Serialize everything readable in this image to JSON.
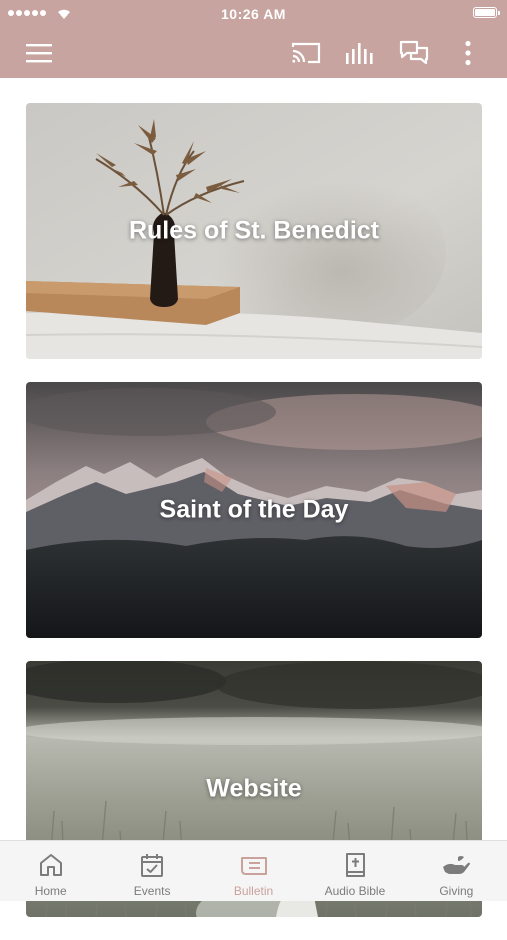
{
  "status_bar": {
    "time": "10:26 AM",
    "battery_level": 1.0
  },
  "app_bar": {
    "icons": [
      "hamburger-menu-icon",
      "cast-icon",
      "audio-bars-icon",
      "chat-bubbles-icon",
      "more-vertical-icon"
    ]
  },
  "colors": {
    "brand": "#c7a49f",
    "active_tab": "#c9a29c",
    "inactive_tab": "#7c7c7c"
  },
  "cards": [
    {
      "title": "Rules of St. Benedict",
      "image": "plant-in-vase-photo"
    },
    {
      "title": "Saint of the Day",
      "image": "snowy-mountains-photo"
    },
    {
      "title": "Website",
      "image": "meadow-bird-photo"
    }
  ],
  "tabs": [
    {
      "label": "Home",
      "icon": "home-icon"
    },
    {
      "label": "Events",
      "icon": "calendar-icon"
    },
    {
      "label": "Bulletin",
      "icon": "bulletin-icon",
      "active": true
    },
    {
      "label": "Audio Bible",
      "icon": "bible-icon"
    },
    {
      "label": "Giving",
      "icon": "giving-hand-icon"
    }
  ]
}
